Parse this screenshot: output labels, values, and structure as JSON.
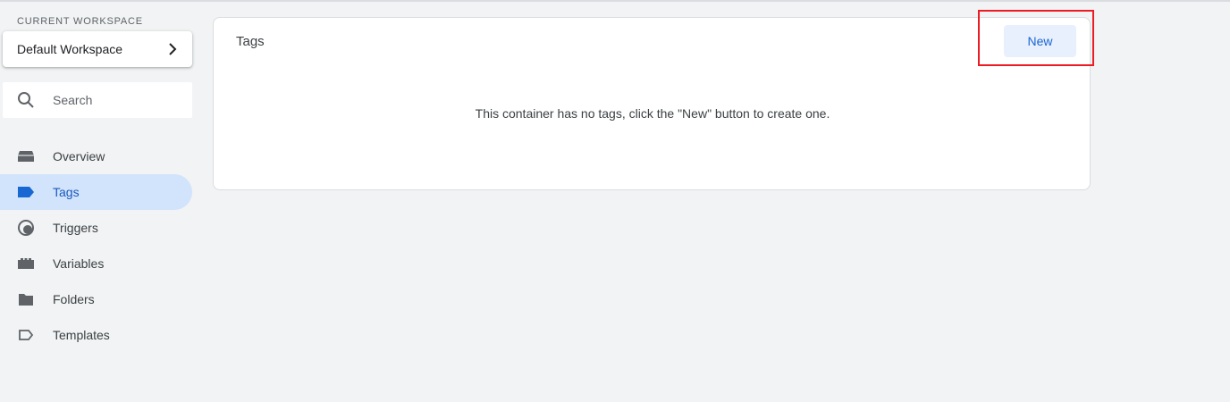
{
  "sidebar": {
    "workspace_caption": "CURRENT WORKSPACE",
    "workspace_name": "Default Workspace",
    "search": {
      "placeholder": "Search"
    },
    "items": [
      {
        "label": "Overview",
        "icon": "overview-icon",
        "active": false
      },
      {
        "label": "Tags",
        "icon": "tag-icon",
        "active": true
      },
      {
        "label": "Triggers",
        "icon": "trigger-icon",
        "active": false
      },
      {
        "label": "Variables",
        "icon": "variables-icon",
        "active": false
      },
      {
        "label": "Folders",
        "icon": "folder-icon",
        "active": false
      },
      {
        "label": "Templates",
        "icon": "template-icon",
        "active": false
      }
    ]
  },
  "main": {
    "title": "Tags",
    "new_button_label": "New",
    "empty_message": "This container has no tags, click the \"New\" button to create one."
  },
  "colors": {
    "accent": "#1a73e8",
    "active_nav_bg": "#d2e3fc",
    "highlight_box": "#ec1c24",
    "page_bg": "#f1f3f4"
  }
}
